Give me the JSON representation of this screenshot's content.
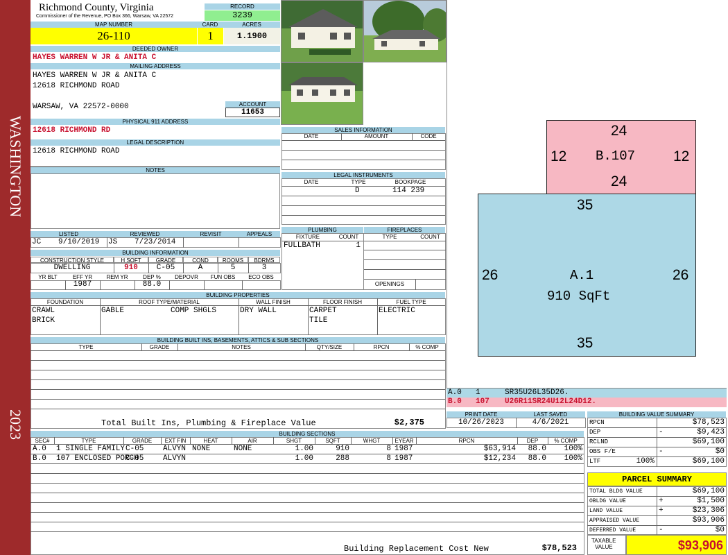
{
  "sidebar": {
    "district": "WASHINGTON",
    "year": "2023"
  },
  "header": {
    "county": "Richmond County, Virginia",
    "address_line": "Commissioner of the Revenue, PO Box 366, Warsaw, VA 22572",
    "record_label": "RECORD",
    "record": "3239"
  },
  "parcel": {
    "map_label": "MAP NUMBER",
    "map_number": "26-110",
    "card_label": "CARD",
    "card": "1",
    "acres_label": "ACRES",
    "acres": "1.1900"
  },
  "owner": {
    "label": "DEEDED OWNER",
    "name": "HAYES WARREN W JR & ANITA C"
  },
  "mailing": {
    "label": "MAILING ADDRESS",
    "line1": "HAYES WARREN W JR & ANITA C",
    "line2": "12618 RICHMOND ROAD",
    "line3": "WARSAW, VA 22572-0000",
    "account_label": "ACCOUNT",
    "account": "11653"
  },
  "physical": {
    "label": "PHYSICAL 911 ADDRESS",
    "address": "12618 RICHMOND RD"
  },
  "legal": {
    "label": "LEGAL DESCRIPTION",
    "text": "12618 RICHMOND ROAD"
  },
  "notes": {
    "label": "NOTES"
  },
  "sales": {
    "label": "SALES INFORMATION",
    "cols": [
      "DATE",
      "AMOUNT",
      "CODE"
    ]
  },
  "instruments": {
    "label": "LEGAL INSTRUMENTS",
    "cols": [
      "DATE",
      "TYPE",
      "BOOKPAGE"
    ],
    "type": "D",
    "bookpage": "114 239"
  },
  "review": {
    "listed_label": "LISTED",
    "reviewed_label": "REVIEWED",
    "revisit_label": "REVISIT",
    "appeals_label": "APPEALS",
    "listed_by": "JC",
    "listed_date": "9/10/2019",
    "reviewed_by": "JS",
    "reviewed_date": "7/23/2014"
  },
  "building_info": {
    "label": "BUILDING INFORMATION",
    "cols1": [
      "CONSTRUCTION STYLE",
      "H SQFT",
      "GRADE",
      "COND",
      "ROOMS",
      "BDRMS"
    ],
    "style": "DWELLING",
    "hsqft": "910",
    "grade": "C-05",
    "cond": "A",
    "rooms": "5",
    "bdrms": "3",
    "cols2": [
      "YR BLT",
      "EFF YR",
      "REM YR",
      "DEP %",
      "DEPOVR",
      "FUN OBS",
      "ECO OBS"
    ],
    "eff_yr": "1987",
    "dep": "88.0"
  },
  "plumbing": {
    "label": "PLUMBING",
    "cols": [
      "FIXTURE",
      "COUNT"
    ],
    "fixture": "FULLBATH",
    "count": "1"
  },
  "fireplaces": {
    "label": "FIREPLACES",
    "cols": [
      "TYPE",
      "COUNT"
    ],
    "openings": "OPENINGS"
  },
  "properties": {
    "label": "BUILDING PROPERTIES",
    "cols": [
      "FOUNDATION",
      "ROOF TYPE/MATERIAL",
      "WALL FINISH",
      "FLOOR FINISH",
      "FUEL TYPE"
    ],
    "foundation1": "CRAWL",
    "foundation2": "BRICK",
    "roof_type": "GABLE",
    "roof_mat": "COMP SHGLS",
    "wall": "DRY WALL",
    "floor1": "CARPET",
    "floor2": "TILE",
    "fuel": "ELECTRIC"
  },
  "builtins": {
    "label": "BUILDING BUILT INS, BASEMENTS, ATTICS & SUB SECTIONS",
    "cols": [
      "TYPE",
      "GRADE",
      "NOTES",
      "QTY/SIZE",
      "RPCN",
      "% COMP"
    ],
    "total_label": "Total Built Ins, Plumbing & Fireplace Value",
    "total": "$2,375"
  },
  "dates": {
    "print_label": "PRINT DATE",
    "print": "10/26/2023",
    "saved_label": "LAST SAVED",
    "saved": "4/6/2021"
  },
  "sketch": {
    "b": {
      "top": "24",
      "left": "12",
      "right": "12",
      "bottom": "24",
      "label": "B.107"
    },
    "a": {
      "top": "35",
      "left": "26",
      "right": "26",
      "bottom": "35",
      "label": "A.1",
      "sqft": "910 SqFt"
    },
    "legend": [
      {
        "code": "A.0",
        "num": "1",
        "path": "SR35U26L35D26.",
        "color": "#add8e6"
      },
      {
        "code": "B.0",
        "num": "107",
        "path": "U26R11SR24U12L24D12.",
        "color": "#f7b8c3"
      }
    ]
  },
  "sections": {
    "label": "BUILDING SECTIONS",
    "cols": [
      "SEC#",
      "TYPE",
      "GRADE",
      "EXT FIN",
      "HEAT",
      "AIR",
      "SHGT",
      "SQFT",
      "WHGT",
      "EYEAR",
      "RPCN",
      "DEP",
      "% COMP"
    ],
    "rows": [
      [
        "A.0",
        "1 SINGLE FAMILY",
        "C-05",
        "ALVYN",
        "NONE",
        "NONE",
        "1.00",
        "910",
        "8",
        "1987",
        "$63,914",
        "88.0",
        "100%"
      ],
      [
        "B.0",
        "107 ENCLOSED PORCH",
        "C-05",
        "ALVYN",
        "",
        "",
        "1.00",
        "288",
        "8",
        "1987",
        "$12,234",
        "88.0",
        "100%"
      ]
    ],
    "replacement_label": "Building Replacement Cost New",
    "replacement": "$78,523"
  },
  "value_summary": {
    "label": "BUILDING VALUE SUMMARY",
    "rows": [
      {
        "label": "RPCN",
        "sign": "",
        "pct": "",
        "value": "$78,523"
      },
      {
        "label": "DEP",
        "sign": "-",
        "pct": "",
        "value": "$9,423"
      },
      {
        "label": "RCLND",
        "sign": "",
        "pct": "",
        "value": "$69,100"
      },
      {
        "label": "OBS F/E",
        "sign": "-",
        "pct": "",
        "value": "$0"
      },
      {
        "label": "LTF",
        "sign": "",
        "pct": "100%",
        "value": "$69,100"
      }
    ]
  },
  "parcel_summary": {
    "label": "PARCEL SUMMARY",
    "rows": [
      {
        "label": "TOTAL BLDG VALUE",
        "sign": "",
        "value": "$69,100"
      },
      {
        "label": "OBLDG VALUE",
        "sign": "+",
        "value": "$1,500"
      },
      {
        "label": "LAND VALUE",
        "sign": "+",
        "value": "$23,306"
      },
      {
        "label": "APPRAISED VALUE",
        "sign": "",
        "value": "$93,906"
      },
      {
        "label": "DEFERRED VALUE",
        "sign": "-",
        "value": "$0"
      }
    ],
    "taxable_label1": "TAXABLE",
    "taxable_label2": "VALUE",
    "taxable": "$93,906"
  }
}
